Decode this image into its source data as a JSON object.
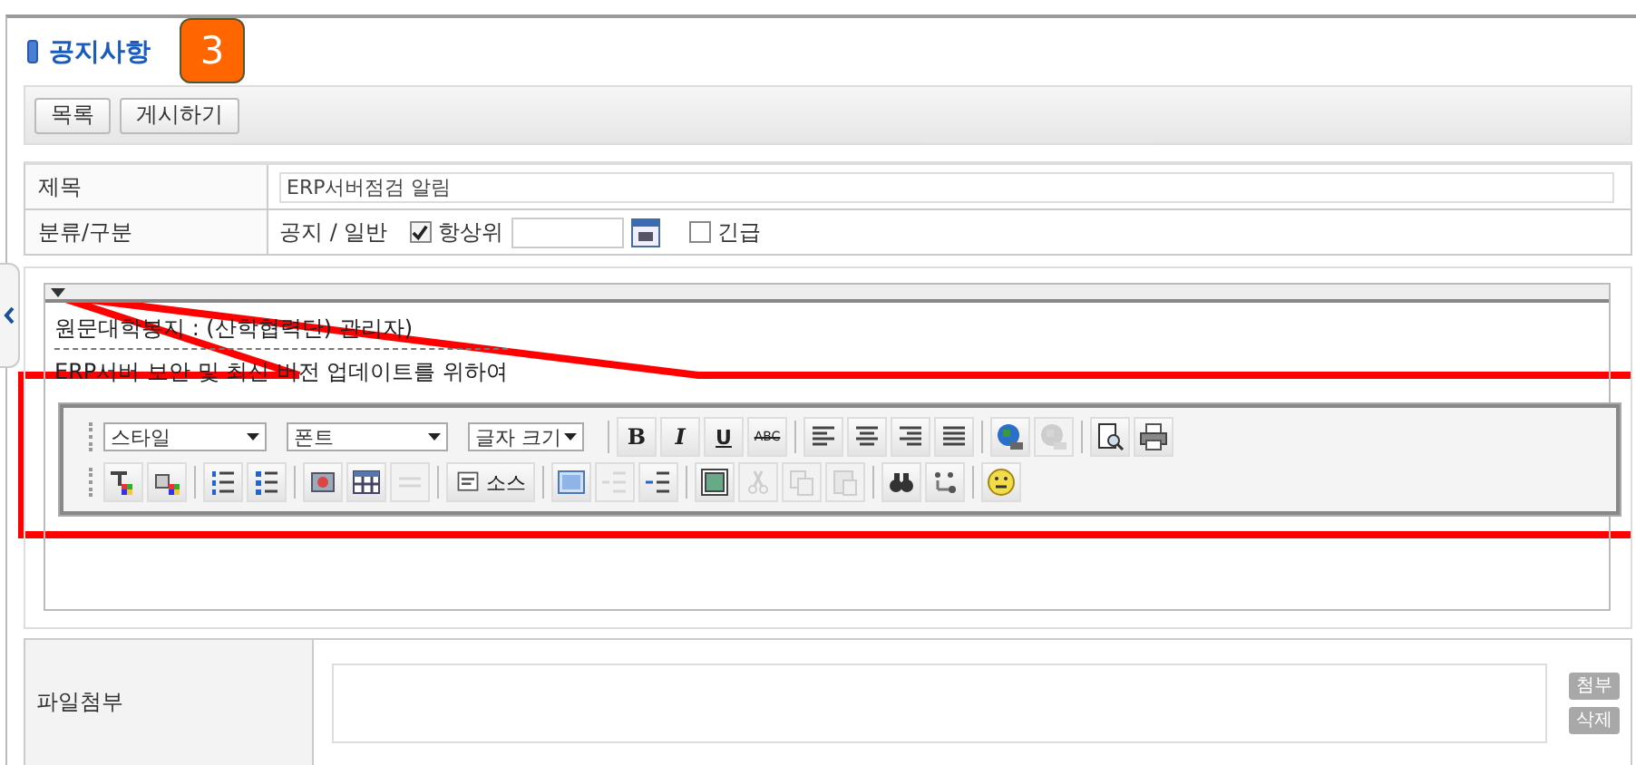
{
  "title": "공지사항",
  "badge": "3",
  "actions": [
    {
      "label": "목록"
    },
    {
      "label": "게시하기"
    }
  ],
  "form": {
    "subject_label": "제목",
    "subject_value": "ERP서버점검 알림",
    "category_label": "분류/구분",
    "category_value": "공지 / 일반",
    "pin": {
      "label": "항상위",
      "checked": true
    },
    "urgent": {
      "label": "긴급",
      "checked": false
    }
  },
  "editor": {
    "lines": [
      {
        "kind": "text",
        "text": "원문대학봉지 : (산학협력단) 관리자)"
      },
      {
        "kind": "divider"
      },
      {
        "kind": "text",
        "text": "ERP서버 보안 및 최신 버전 업데이트를 위하여"
      }
    ],
    "toolbar": [
      [
        [
          {
            "kind": "select",
            "label": "스타일"
          },
          {
            "kind": "select",
            "label": "폰트"
          },
          {
            "kind": "select",
            "label": "글자 크기"
          }
        ],
        [
          {
            "kind": "text",
            "label": "B",
            "disabled": false
          },
          {
            "kind": "text",
            "label": "I",
            "disabled": false
          },
          {
            "kind": "text",
            "label": "U",
            "disabled": false
          },
          {
            "kind": "text",
            "label": "ABC",
            "disabled": false
          }
        ],
        [
          {
            "kind": "icon",
            "disabled": false
          },
          {
            "kind": "icon",
            "disabled": false
          },
          {
            "kind": "icon",
            "disabled": false
          },
          {
            "kind": "icon",
            "disabled": false
          }
        ],
        [
          {
            "kind": "icon",
            "disabled": false
          },
          {
            "kind": "icon",
            "disabled": true
          }
        ],
        [
          {
            "kind": "icon",
            "disabled": false
          },
          {
            "kind": "icon",
            "disabled": false
          }
        ]
      ],
      [
        [
          {
            "kind": "icon",
            "disabled": false
          },
          {
            "kind": "icon",
            "disabled": false
          }
        ],
        [
          {
            "kind": "icon",
            "disabled": false
          },
          {
            "kind": "icon",
            "disabled": false
          }
        ],
        [
          {
            "kind": "icon",
            "disabled": false
          },
          {
            "kind": "icon",
            "disabled": false
          },
          {
            "kind": "icon",
            "disabled": true
          }
        ],
        [
          {
            "kind": "icon-text",
            "label": "소스",
            "disabled": false
          }
        ],
        [
          {
            "kind": "icon",
            "disabled": false
          },
          {
            "kind": "icon",
            "disabled": true
          },
          {
            "kind": "icon",
            "disabled": false
          }
        ],
        [
          {
            "kind": "icon",
            "disabled": false
          },
          {
            "kind": "icon",
            "disabled": true
          },
          {
            "kind": "icon",
            "disabled": true
          },
          {
            "kind": "icon",
            "disabled": true
          }
        ],
        [
          {
            "kind": "icon",
            "disabled": false
          },
          {
            "kind": "icon",
            "disabled": false
          }
        ],
        [
          {
            "kind": "icon",
            "disabled": false
          }
        ]
      ]
    ]
  },
  "attachment": {
    "label": "파일첨부",
    "buttons": [
      {
        "label": "첨부"
      },
      {
        "label": "삭제"
      }
    ]
  }
}
